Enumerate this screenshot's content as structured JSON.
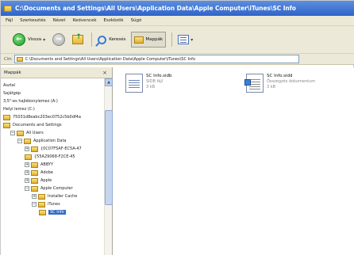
{
  "window": {
    "title": "C:\\Documents and Settings\\All Users\\Application Data\\Apple Computer\\iTunes\\SC Info"
  },
  "menu": [
    "Fájl",
    "Szerkesztés",
    "Nézet",
    "Kedvencek",
    "Eszközök",
    "Súgó"
  ],
  "toolbar": {
    "back_label": "Vissza",
    "search_label": "Keresés",
    "folders_label": "Mappák"
  },
  "address": {
    "label": "Cím",
    "path": "C:\\Documents and Settings\\All Users\\Application Data\\Apple Computer\\iTunes\\SC Info"
  },
  "left_pane": {
    "title": "Mappák",
    "tree": [
      {
        "label": "Asztal",
        "indent": 0,
        "expander": "",
        "folder": false,
        "selected": false
      },
      {
        "label": "Sajátgép",
        "indent": 0,
        "expander": "",
        "folder": false,
        "selected": false
      },
      {
        "label": "3,5\"-es hajlékonylemez (A:)",
        "indent": 0,
        "expander": "",
        "folder": false,
        "selected": false
      },
      {
        "label": "Helyi lemez (C:)",
        "indent": 0,
        "expander": "",
        "folder": false,
        "selected": false
      },
      {
        "label": "75031d8eabc203ec0752c5b0df4a",
        "indent": 0,
        "expander": "",
        "folder": true,
        "selected": false
      },
      {
        "label": "Documents and Settings",
        "indent": 0,
        "expander": "",
        "folder": true,
        "selected": false
      },
      {
        "label": "All Users",
        "indent": 1,
        "expander": "−",
        "folder": true,
        "selected": false
      },
      {
        "label": "Application Data",
        "indent": 2,
        "expander": "−",
        "folder": true,
        "selected": false
      },
      {
        "label": "{0C07F5AF-EC5A-47",
        "indent": 3,
        "expander": "+",
        "folder": true,
        "selected": false
      },
      {
        "label": "{55A29068-F2CE-45",
        "indent": 3,
        "expander": "",
        "folder": true,
        "selected": false
      },
      {
        "label": "ABBYY",
        "indent": 3,
        "expander": "+",
        "folder": true,
        "selected": false
      },
      {
        "label": "Adobe",
        "indent": 3,
        "expander": "+",
        "folder": true,
        "selected": false
      },
      {
        "label": "Apple",
        "indent": 3,
        "expander": "+",
        "folder": true,
        "selected": false
      },
      {
        "label": "Apple Computer",
        "indent": 3,
        "expander": "−",
        "folder": true,
        "selected": false
      },
      {
        "label": "Installer Cache",
        "indent": 4,
        "expander": "+",
        "folder": true,
        "selected": false
      },
      {
        "label": "iTunes",
        "indent": 4,
        "expander": "−",
        "folder": true,
        "selected": false
      },
      {
        "label": "SC Info",
        "indent": 5,
        "expander": "",
        "folder": true,
        "selected": true
      }
    ]
  },
  "files": [
    {
      "name": "SC Info.sidb",
      "type": "SIDB fájl",
      "size": "3 kB",
      "icon": "database-file-icon"
    },
    {
      "name": "SC Info.sidd",
      "type": "Összegzés dokumentum",
      "size": "3 kB",
      "icon": "document-file-icon"
    }
  ]
}
